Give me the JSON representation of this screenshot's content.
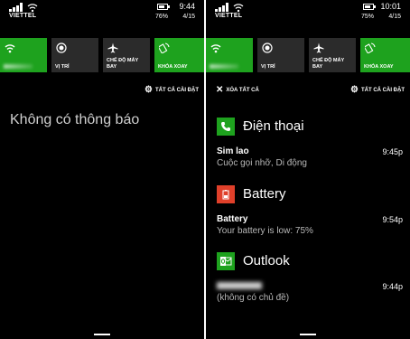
{
  "left": {
    "status": {
      "carrier": "VIETTEL",
      "time": "9:44",
      "battery_pct": "76%",
      "date": "4/15"
    },
    "tiles": [
      {
        "label": "",
        "active": true
      },
      {
        "label": "VỊ TRÍ",
        "active": false
      },
      {
        "label": "CHẾ ĐỘ MÁY BAY",
        "active": false
      },
      {
        "label": "KHÓA XOAY",
        "active": true
      }
    ],
    "settings_label": "TẤT CẢ CÀI ĐẶT",
    "empty_message": "Không có thông báo"
  },
  "right": {
    "status": {
      "carrier": "VIETTEL",
      "time": "10:01",
      "battery_pct": "75%",
      "date": "4/15"
    },
    "tiles": [
      {
        "label": "",
        "active": true
      },
      {
        "label": "VỊ TRÍ",
        "active": false
      },
      {
        "label": "CHẾ ĐỘ MÁY BAY",
        "active": false
      },
      {
        "label": "KHÓA XOAY",
        "active": true
      }
    ],
    "clear_all_label": "XÓA TẤT CẢ",
    "settings_label": "TẤT CẢ CÀI ĐẶT",
    "groups": [
      {
        "app": "Điện thoại",
        "icon": "phone-icon",
        "color": "#1ea21e",
        "items": [
          {
            "title": "Sim lao",
            "subtitle": "Cuộc gọi nhỡ, Di động",
            "time": "9:45p"
          }
        ]
      },
      {
        "app": "Battery",
        "icon": "battery-icon",
        "color": "#e0402a",
        "items": [
          {
            "title": "Battery",
            "subtitle": "Your battery is low: 75%",
            "time": "9:54p"
          }
        ]
      },
      {
        "app": "Outlook",
        "icon": "outlook-icon",
        "color": "#1ea21e",
        "items": [
          {
            "title": "",
            "subtitle": "(không có chủ đề)",
            "time": "9:44p"
          }
        ]
      }
    ]
  },
  "colors": {
    "accent": "#1ea21e",
    "tile_inactive": "#2b2b2b",
    "background": "#000000"
  }
}
